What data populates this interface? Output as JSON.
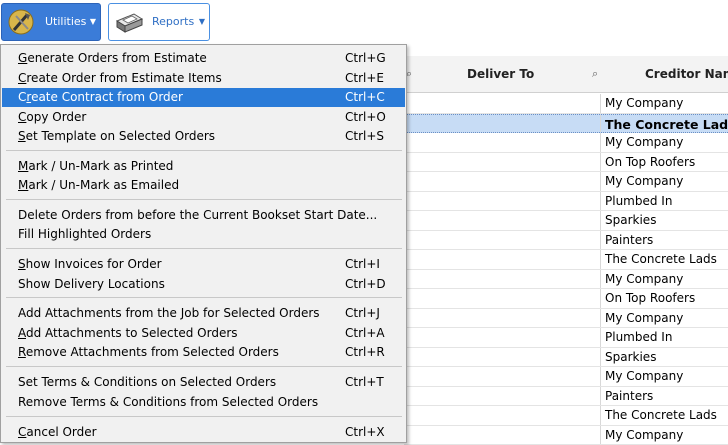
{
  "toolbar": {
    "utilities_label": "Utilities",
    "reports_label": "Reports",
    "accent": "#3b7cd8"
  },
  "grid": {
    "columns": [
      {
        "label": "Deliver To",
        "icon": "search-icon"
      },
      {
        "label": "Creditor Nam",
        "icon": "search-icon"
      }
    ],
    "rows": [
      {
        "creditor": "My Company",
        "selected": false
      },
      {
        "creditor": "The Concrete Lads",
        "selected": true
      },
      {
        "creditor": "My Company",
        "selected": false
      },
      {
        "creditor": "On Top Roofers",
        "selected": false
      },
      {
        "creditor": "My Company",
        "selected": false
      },
      {
        "creditor": "Plumbed In",
        "selected": false
      },
      {
        "creditor": "Sparkies",
        "selected": false
      },
      {
        "creditor": "Painters",
        "selected": false
      },
      {
        "creditor": "The Concrete Lads",
        "selected": false
      },
      {
        "creditor": "My Company",
        "selected": false
      },
      {
        "creditor": "On Top Roofers",
        "selected": false
      },
      {
        "creditor": "My Company",
        "selected": false
      },
      {
        "creditor": "Plumbed In",
        "selected": false
      },
      {
        "creditor": "Sparkies",
        "selected": false
      },
      {
        "creditor": "My Company",
        "selected": false
      },
      {
        "creditor": "Painters",
        "selected": false
      },
      {
        "creditor": "The Concrete Lads",
        "selected": false
      },
      {
        "creditor": "My Company",
        "selected": false
      }
    ]
  },
  "menu": {
    "items": [
      {
        "label": "Generate Orders from Estimate",
        "shortcut": "Ctrl+G"
      },
      {
        "label": "Create Order from Estimate Items",
        "shortcut": "Ctrl+E"
      },
      {
        "label": "Create Contract from Order",
        "shortcut": "Ctrl+C",
        "highlighted": true
      },
      {
        "label": "Copy Order",
        "shortcut": "Ctrl+O"
      },
      {
        "label": "Set Template on Selected Orders",
        "shortcut": "Ctrl+S"
      },
      {
        "label": "Mark / Un-Mark as Printed",
        "shortcut": ""
      },
      {
        "label": "Mark / Un-Mark as Emailed",
        "shortcut": ""
      },
      {
        "label": "Delete Orders from before the Current Bookset Start Date...",
        "shortcut": ""
      },
      {
        "label": "Fill Highlighted Orders",
        "shortcut": ""
      },
      {
        "label": "Show Invoices for Order",
        "shortcut": "Ctrl+I"
      },
      {
        "label": "Show Delivery Locations",
        "shortcut": "Ctrl+D"
      },
      {
        "label": "Add Attachments from the Job for Selected Orders",
        "shortcut": "Ctrl+J"
      },
      {
        "label": "Add Attachments to Selected Orders",
        "shortcut": "Ctrl+A"
      },
      {
        "label": "Remove Attachments from Selected Orders",
        "shortcut": "Ctrl+R"
      },
      {
        "label": "Set Terms & Conditions on Selected Orders",
        "shortcut": "Ctrl+T"
      },
      {
        "label": "Remove Terms & Conditions from Selected Orders",
        "shortcut": ""
      },
      {
        "label": "Cancel Order",
        "shortcut": "Ctrl+X"
      }
    ]
  }
}
